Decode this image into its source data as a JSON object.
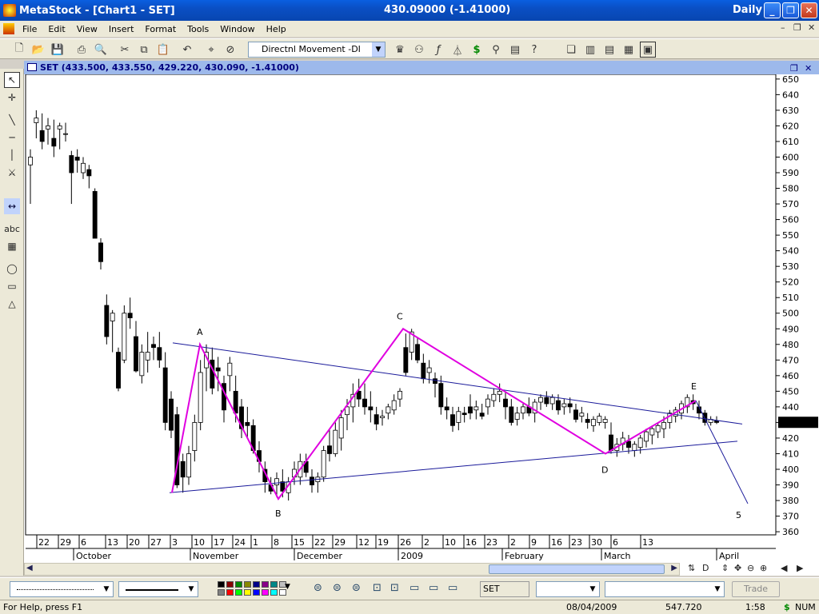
{
  "window": {
    "title": "MetaStock - [Chart1 - SET]",
    "center_quote": "430.09000 (-1.41000)",
    "periodicity": "Daily"
  },
  "menu": [
    "File",
    "Edit",
    "View",
    "Insert",
    "Format",
    "Tools",
    "Window",
    "Help"
  ],
  "toolbar": {
    "indicator_select": "Directnl Movement -DI"
  },
  "chart_window": {
    "title": "SET (433.500, 433.550, 429.220, 430.090, -1.41000)",
    "last_price_label": "430.090"
  },
  "chart_data": {
    "type": "candlestick",
    "symbol": "SET",
    "ylim": [
      358,
      653
    ],
    "y_ticks": [
      650,
      640,
      630,
      620,
      610,
      600,
      590,
      580,
      570,
      560,
      550,
      540,
      530,
      520,
      510,
      500,
      490,
      480,
      470,
      460,
      450,
      440,
      430,
      420,
      410,
      400,
      390,
      380,
      370,
      360
    ],
    "x_day_labels": [
      "22",
      "29",
      "6",
      "13",
      "20",
      "27",
      "3",
      "10",
      "17",
      "24",
      "1",
      "8",
      "15",
      "22",
      "29",
      "12",
      "19",
      "26",
      "2",
      "10",
      "16",
      "23",
      "2",
      "9",
      "16",
      "23",
      "30",
      "6",
      "13"
    ],
    "x_month_labels": [
      "October",
      "November",
      "December",
      "2009",
      "February",
      "March",
      "April"
    ],
    "wave_labels": [
      "A",
      "B",
      "C",
      "D",
      "E",
      "5"
    ],
    "wave_points": [
      {
        "label": "start",
        "price": 385
      },
      {
        "label": "A",
        "price": 480
      },
      {
        "label": "B",
        "price": 381
      },
      {
        "label": "C",
        "price": 490
      },
      {
        "label": "D",
        "price": 410
      },
      {
        "label": "E",
        "price": 444
      },
      {
        "label": "5",
        "price": 378
      }
    ],
    "trendlines": [
      {
        "name": "upper",
        "from_price": 481,
        "to_price": 429
      },
      {
        "name": "lower",
        "from_price": 385,
        "to_price": 418
      }
    ],
    "ohlc": [
      [
        595,
        605,
        570,
        600
      ],
      [
        622,
        630,
        612,
        625
      ],
      [
        617,
        628,
        605,
        610
      ],
      [
        618,
        625,
        608,
        620
      ],
      [
        612,
        624,
        600,
        607
      ],
      [
        618,
        622,
        605,
        620
      ],
      [
        615,
        622,
        610,
        615
      ],
      [
        601,
        604,
        570,
        590
      ],
      [
        600,
        605,
        590,
        598
      ],
      [
        590,
        600,
        586,
        596
      ],
      [
        592,
        595,
        580,
        588
      ],
      [
        578,
        580,
        548,
        548
      ],
      [
        545,
        548,
        528,
        533
      ],
      [
        505,
        512,
        480,
        485
      ],
      [
        495,
        502,
        475,
        500
      ],
      [
        475,
        478,
        450,
        452
      ],
      [
        470,
        505,
        468,
        500
      ],
      [
        500,
        510,
        490,
        497
      ],
      [
        485,
        495,
        462,
        463
      ],
      [
        460,
        480,
        455,
        475
      ],
      [
        470,
        488,
        462,
        475
      ],
      [
        480,
        485,
        470,
        478
      ],
      [
        478,
        488,
        465,
        470
      ],
      [
        465,
        475,
        425,
        430
      ],
      [
        445,
        450,
        420,
        425
      ],
      [
        435,
        440,
        388,
        390
      ],
      [
        405,
        410,
        385,
        395
      ],
      [
        395,
        415,
        390,
        410
      ],
      [
        412,
        435,
        405,
        430
      ],
      [
        430,
        470,
        425,
        462
      ],
      [
        465,
        480,
        450,
        475
      ],
      [
        470,
        478,
        448,
        452
      ],
      [
        465,
        472,
        450,
        463
      ],
      [
        455,
        460,
        430,
        438
      ],
      [
        460,
        472,
        450,
        468
      ],
      [
        450,
        460,
        430,
        436
      ],
      [
        440,
        445,
        420,
        426
      ],
      [
        430,
        440,
        420,
        428
      ],
      [
        428,
        432,
        410,
        412
      ],
      [
        412,
        418,
        398,
        405
      ],
      [
        400,
        405,
        385,
        392
      ],
      [
        390,
        395,
        384,
        386
      ],
      [
        390,
        398,
        382,
        394
      ],
      [
        392,
        400,
        382,
        386
      ],
      [
        385,
        395,
        380,
        392
      ],
      [
        395,
        405,
        390,
        400
      ],
      [
        395,
        410,
        390,
        405
      ],
      [
        405,
        410,
        395,
        398
      ],
      [
        395,
        400,
        385,
        390
      ],
      [
        392,
        398,
        385,
        395
      ],
      [
        395,
        415,
        392,
        412
      ],
      [
        415,
        425,
        405,
        410
      ],
      [
        410,
        430,
        408,
        425
      ],
      [
        420,
        438,
        412,
        433
      ],
      [
        435,
        445,
        425,
        440
      ],
      [
        440,
        455,
        430,
        448
      ],
      [
        450,
        458,
        440,
        445
      ],
      [
        445,
        455,
        435,
        440
      ],
      [
        440,
        450,
        430,
        438
      ],
      [
        435,
        440,
        425,
        429
      ],
      [
        433,
        438,
        428,
        434
      ],
      [
        436,
        442,
        432,
        440
      ],
      [
        438,
        448,
        435,
        444
      ],
      [
        445,
        452,
        440,
        450
      ],
      [
        478,
        487,
        460,
        462
      ],
      [
        475,
        490,
        470,
        488
      ],
      [
        480,
        484,
        468,
        470
      ],
      [
        468,
        474,
        455,
        458
      ],
      [
        462,
        470,
        455,
        465
      ],
      [
        458,
        462,
        446,
        455
      ],
      [
        455,
        460,
        435,
        440
      ],
      [
        440,
        446,
        432,
        438
      ],
      [
        435,
        440,
        424,
        428
      ],
      [
        430,
        440,
        425,
        437
      ],
      [
        436,
        440,
        430,
        435
      ],
      [
        440,
        448,
        432,
        436
      ],
      [
        438,
        444,
        432,
        440
      ],
      [
        436,
        442,
        432,
        434
      ],
      [
        440,
        448,
        435,
        445
      ],
      [
        444,
        452,
        440,
        448
      ],
      [
        448,
        455,
        443,
        450
      ],
      [
        445,
        450,
        432,
        440
      ],
      [
        440,
        445,
        428,
        430
      ],
      [
        432,
        440,
        428,
        436
      ],
      [
        436,
        442,
        432,
        440
      ],
      [
        440,
        446,
        434,
        436
      ],
      [
        436,
        445,
        430,
        443
      ],
      [
        443,
        448,
        438,
        446
      ],
      [
        446,
        450,
        440,
        442
      ],
      [
        442,
        448,
        438,
        446
      ],
      [
        444,
        448,
        435,
        438
      ],
      [
        440,
        445,
        435,
        442
      ],
      [
        442,
        446,
        436,
        440
      ],
      [
        438,
        442,
        430,
        432
      ],
      [
        434,
        440,
        430,
        436
      ],
      [
        432,
        436,
        426,
        430
      ],
      [
        428,
        434,
        424,
        432
      ],
      [
        430,
        436,
        428,
        434
      ],
      [
        430,
        434,
        426,
        432
      ],
      [
        422,
        430,
        410,
        412
      ],
      [
        412,
        420,
        408,
        416
      ],
      [
        416,
        424,
        412,
        420
      ],
      [
        418,
        422,
        410,
        414
      ],
      [
        412,
        418,
        408,
        416
      ],
      [
        414,
        422,
        410,
        420
      ],
      [
        418,
        426,
        414,
        424
      ],
      [
        422,
        428,
        416,
        426
      ],
      [
        424,
        430,
        420,
        428
      ],
      [
        426,
        434,
        420,
        430
      ],
      [
        430,
        438,
        426,
        436
      ],
      [
        434,
        440,
        430,
        438
      ],
      [
        436,
        444,
        432,
        442
      ],
      [
        440,
        448,
        436,
        446
      ],
      [
        444,
        448,
        438,
        442
      ],
      [
        440,
        444,
        432,
        436
      ],
      [
        436,
        438,
        428,
        430
      ],
      [
        430,
        434,
        428,
        432
      ],
      [
        431,
        434,
        429,
        430
      ]
    ]
  },
  "bottom": {
    "security_box": "SET"
  },
  "status": {
    "help": "For Help, press F1",
    "date": "08/04/2009",
    "value": "547.720",
    "time": "1:58",
    "mode": "NUM"
  }
}
